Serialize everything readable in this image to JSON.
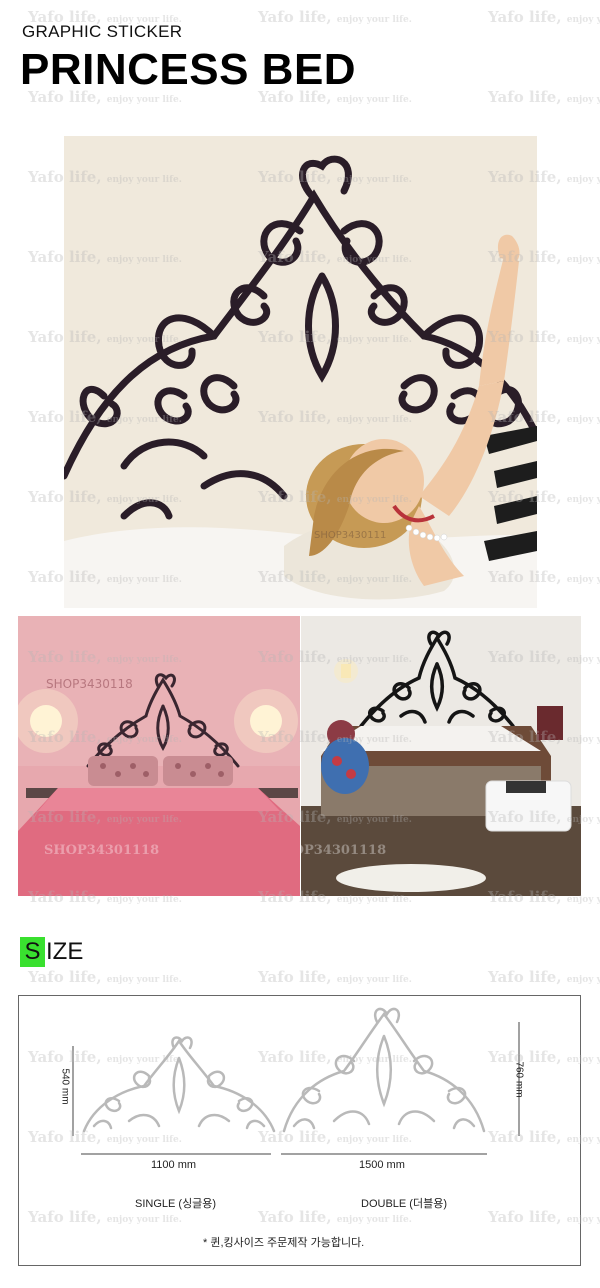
{
  "header": {
    "kicker": "GRAPHIC STICKER",
    "title": "PRINCESS BED"
  },
  "photos": {
    "main_overlay_text": "SHOP3430111",
    "pink_room_overlay_top": "SHOP3430118",
    "pink_room_overlay_bottom": "SHOP34301118",
    "white_room_overlay": "SHOP34301118"
  },
  "size_section": {
    "heading_first_letter": "S",
    "heading_rest": "IZE",
    "accent_color": "#39e02f",
    "single": {
      "height": "540 mm",
      "width": "1100 mm",
      "label": "SINGLE (싱글용)"
    },
    "double": {
      "height": "760 mm",
      "width": "1500 mm",
      "label": "DOUBLE (더블용)"
    },
    "footnote": "* 퀸,킹사이즈 주문제작 가능합니다."
  },
  "watermark": {
    "brand": "Yafo life,",
    "tagline": "enjoy your life."
  }
}
